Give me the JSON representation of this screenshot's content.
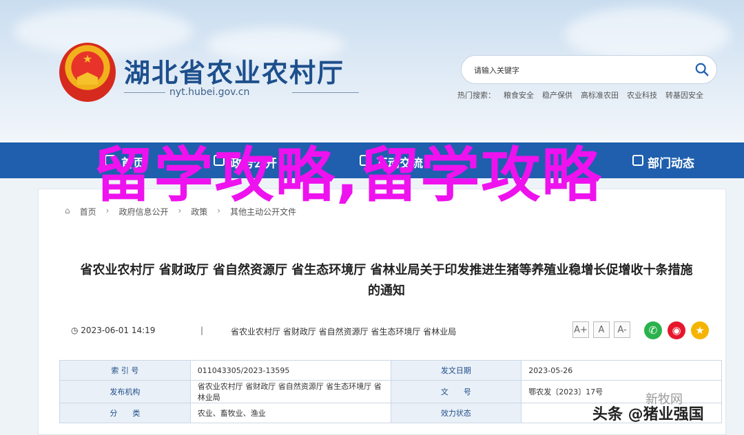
{
  "header": {
    "site_title": "湖北省农业农村厅",
    "site_domain": "nyt.hubei.gov.cn",
    "search_placeholder": "请输入关键字",
    "hot_search_label": "热门搜索：",
    "hot_search_items": [
      "粮食安全",
      "稳产保供",
      "高标准农田",
      "农业科技",
      "转基因安全"
    ]
  },
  "nav": {
    "items": [
      "首页",
      "政务公开",
      "互动交流",
      "部门动态"
    ]
  },
  "breadcrumb": [
    "首页",
    "政府信息公开",
    "政策",
    "其他主动公开文件"
  ],
  "article": {
    "title": "省农业农村厅 省财政厅 省自然资源厅 省生态环境厅 省林业局关于印发推进生猪等养殖业稳增长促增收十条措施的通知",
    "date": "2023-06-01 14:19",
    "separator": "|",
    "orgs": "省农业农村厅 省财政厅 省自然资源厅 省生态环境厅 省林业局",
    "font_buttons": [
      "A+",
      "A",
      "A-"
    ]
  },
  "meta_table": [
    {
      "k1": "索 引 号",
      "v1": "011043305/2023-13595",
      "k2": "发文日期",
      "v2": "2023-05-26"
    },
    {
      "k1": "发布机构",
      "v1": "省农业农村厅 省财政厅 省自然资源厅 省生态环境厅 省林业局",
      "k2": "文　　号",
      "v2": "鄂农发〔2023〕17号"
    },
    {
      "k1": "分　　类",
      "v1": "农业、畜牧业、渔业",
      "k2": "效力状态",
      "v2": ""
    }
  ],
  "overlay": {
    "text": "留学攻略,留学攻略",
    "color": "#ee12ee"
  },
  "watermarks": {
    "toutiao": "头条 @猪业强国",
    "xinmu": "新牧网"
  },
  "colors": {
    "brand_blue": "#1f5fae",
    "title_blue": "#1d4f8c"
  }
}
